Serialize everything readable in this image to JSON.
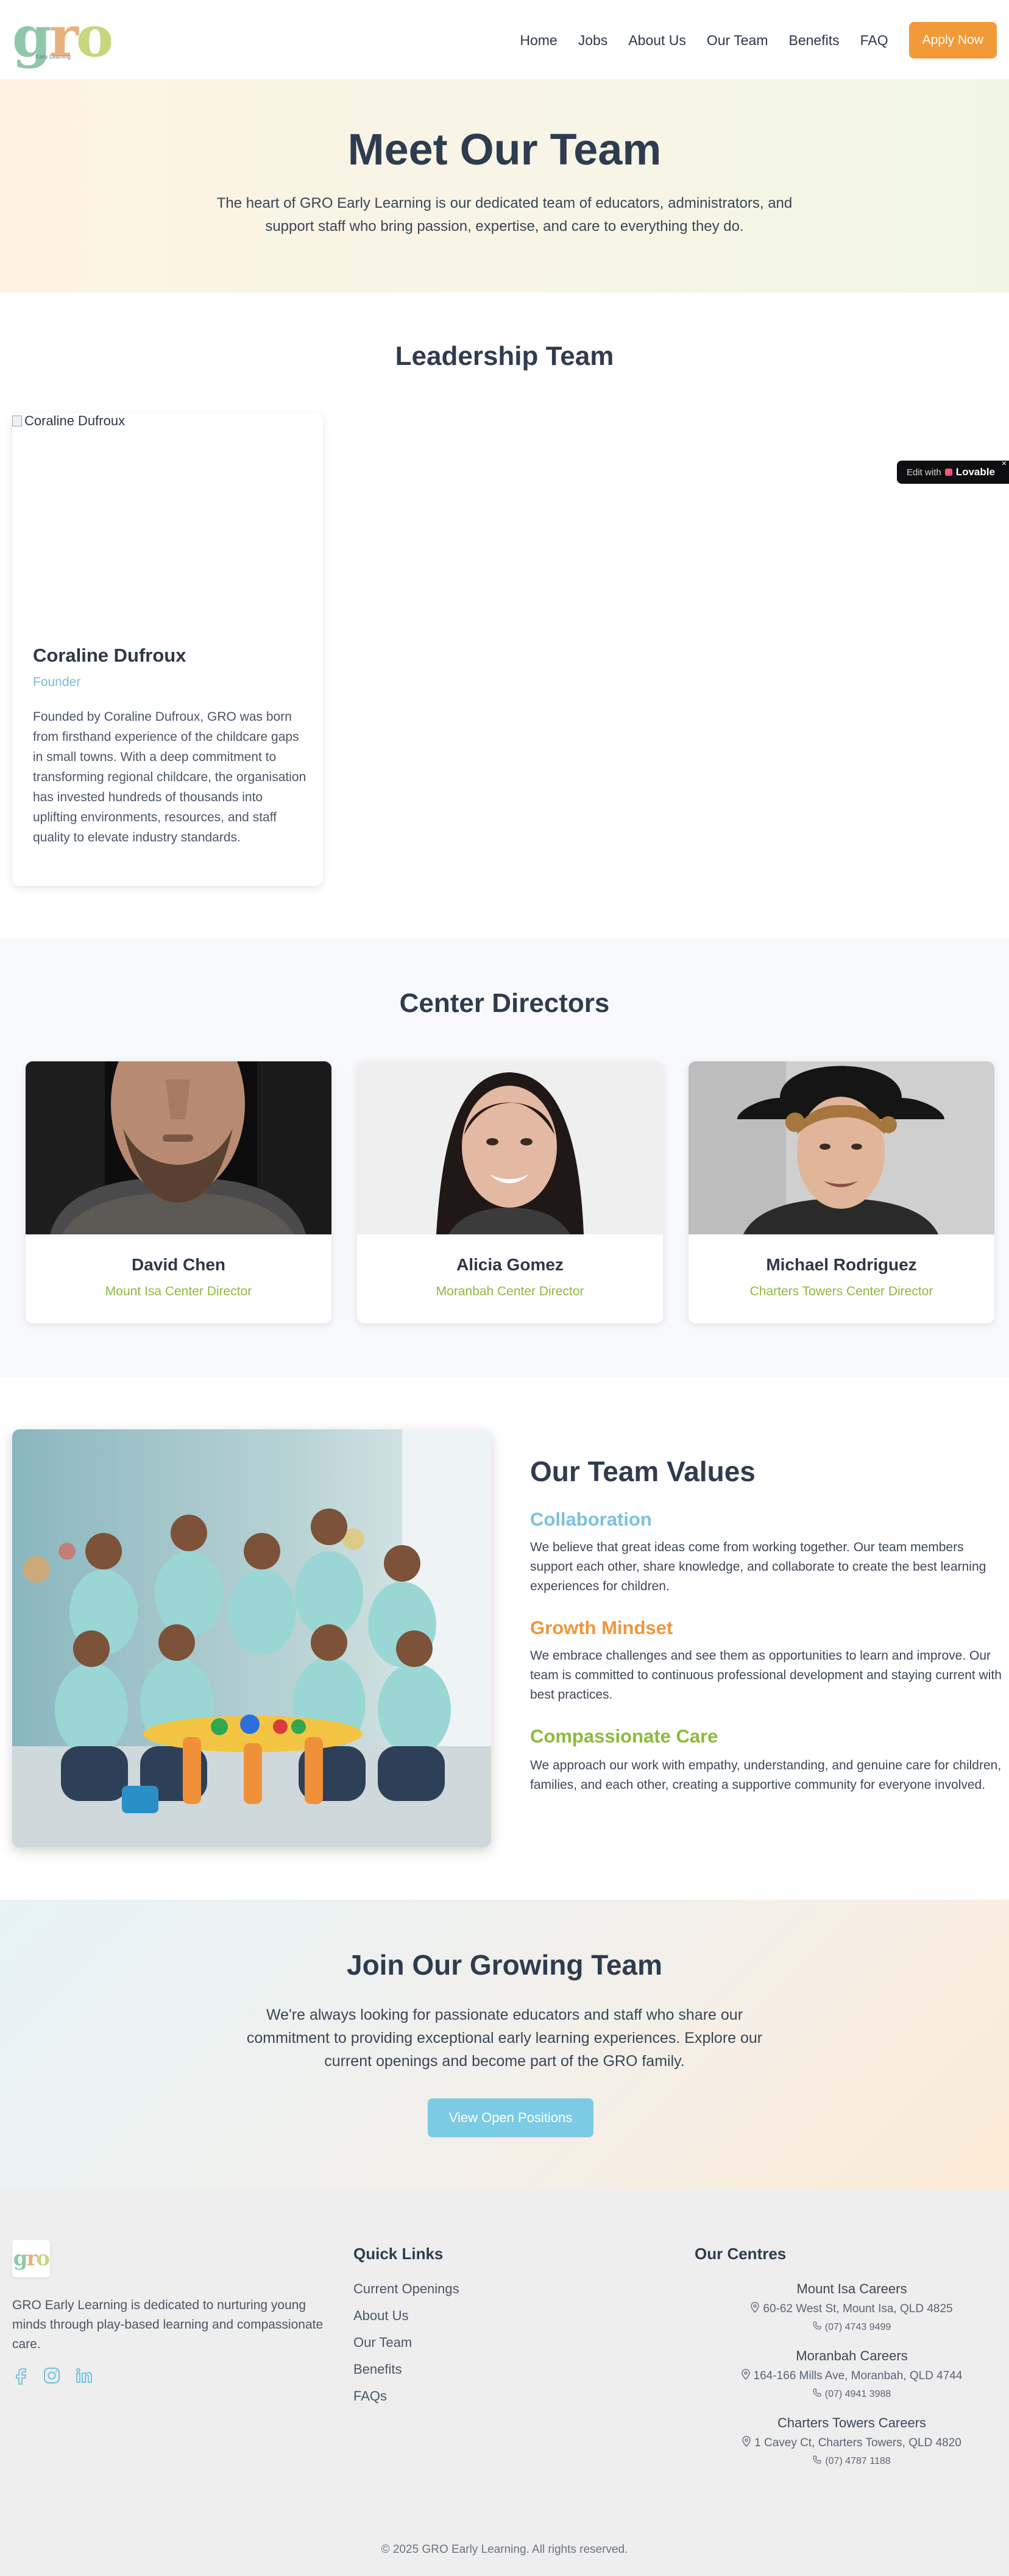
{
  "header": {
    "logo_text": "gro",
    "logo_sub": "Early Learning",
    "nav": [
      "Home",
      "Jobs",
      "About Us",
      "Our Team",
      "Benefits",
      "FAQ"
    ],
    "apply_label": "Apply Now"
  },
  "hero": {
    "title": "Meet Our Team",
    "subtitle": "The heart of GRO Early Learning is our dedicated team of educators, administrators, and support staff who bring passion, expertise, and care to everything they do."
  },
  "leadership": {
    "title": "Leadership Team",
    "leader": {
      "img_alt": "Coraline Dufroux",
      "name": "Coraline Dufroux",
      "role": "Founder",
      "bio": "Founded by Coraline Dufroux, GRO was born from firsthand experience of the childcare gaps in small towns. With a deep commitment to transforming regional childcare, the organisation has invested hundreds of thousands into uplifting environments, resources, and staff quality to elevate industry standards."
    }
  },
  "badge": {
    "prefix": "Edit with",
    "brand": "Lovable",
    "close": "×"
  },
  "directors": {
    "title": "Center Directors",
    "items": [
      {
        "name": "David Chen",
        "role": "Mount Isa Center Director"
      },
      {
        "name": "Alicia Gomez",
        "role": "Moranbah Center Director"
      },
      {
        "name": "Michael Rodriguez",
        "role": "Charters Towers Center Director"
      }
    ]
  },
  "values": {
    "title": "Our Team Values",
    "items": [
      {
        "heading": "Collaboration",
        "color": "#7cc1dc",
        "text": "We believe that great ideas come from working together. Our team members support each other, share knowledge, and collaborate to create the best learning experiences for children."
      },
      {
        "heading": "Growth Mindset",
        "color": "#f0963a",
        "text": "We embrace challenges and see them as opportunities to learn and improve. Our team is committed to continuous professional development and staying current with best practices."
      },
      {
        "heading": "Compassionate Care",
        "color": "#8dba3c",
        "text": "We approach our work with empathy, understanding, and genuine care for children, families, and each other, creating a supportive community for everyone involved."
      }
    ]
  },
  "join": {
    "title": "Join Our Growing Team",
    "text": "We're always looking for passionate educators and staff who share our commitment to providing exceptional early learning experiences. Explore our current openings and become part of the GRO family.",
    "button": "View Open Positions"
  },
  "footer": {
    "about": "GRO Early Learning is dedicated to nurturing young minds through play-based learning and compassionate care.",
    "quick_links_title": "Quick Links",
    "quick_links": [
      "Current Openings",
      "About Us",
      "Our Team",
      "Benefits",
      "FAQs"
    ],
    "centres_title": "Our Centres",
    "centres": [
      {
        "name": "Mount Isa Careers",
        "address": "60-62 West St, Mount Isa, QLD 4825",
        "phone": "(07) 4743 9499"
      },
      {
        "name": "Moranbah Careers",
        "address": "164-166 Mills Ave, Moranbah, QLD 4744",
        "phone": "(07) 4941 3988"
      },
      {
        "name": "Charters Towers Careers",
        "address": "1 Cavey Ct, Charters Towers, QLD 4820",
        "phone": "(07) 4787 1188"
      }
    ],
    "copyright": "© 2025 GRO Early Learning. All rights reserved."
  },
  "icons": {
    "social": [
      "facebook-icon",
      "instagram-icon",
      "linkedin-icon"
    ],
    "brand_colors": {
      "orange": "#f29a38",
      "blue": "#7ccbe4",
      "green": "#8dba3c"
    }
  }
}
